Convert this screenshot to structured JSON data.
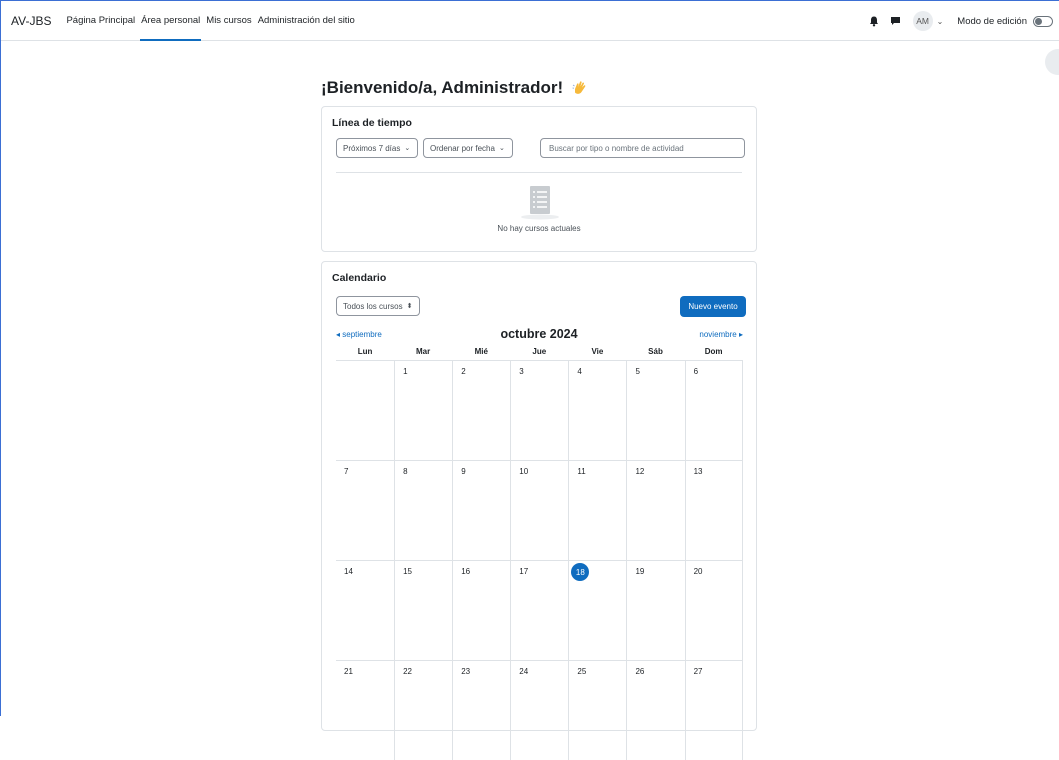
{
  "navbar": {
    "brand": "AV-JBS",
    "links": [
      {
        "label": "Página Principal"
      },
      {
        "label": "Área personal"
      },
      {
        "label": "Mis cursos"
      },
      {
        "label": "Administración del sitio"
      }
    ],
    "active_link": "Área personal",
    "avatar_initials": "AM",
    "edit_mode_label": "Modo de edición",
    "edit_mode_on": false
  },
  "page": {
    "welcome": "¡Bienvenido/a, Administrador!"
  },
  "timeline": {
    "title": "Línea de tiempo",
    "filter_label": "Próximos 7 días",
    "sort_label": "Ordenar por fecha",
    "search_placeholder": "Buscar por tipo o nombre de actividad",
    "empty_text": "No hay cursos actuales"
  },
  "calendar": {
    "title": "Calendario",
    "course_filter": "Todos los cursos",
    "new_event_label": "Nuevo evento",
    "prev_month": "septiembre",
    "next_month": "noviembre",
    "month_title": "octubre 2024",
    "weekdays": [
      "Lun",
      "Mar",
      "Mié",
      "Jue",
      "Vie",
      "Sáb",
      "Dom"
    ],
    "weeks": [
      [
        "",
        "1",
        "2",
        "3",
        "4",
        "5",
        "6"
      ],
      [
        "7",
        "8",
        "9",
        "10",
        "11",
        "12",
        "13"
      ],
      [
        "14",
        "15",
        "16",
        "17",
        "18",
        "19",
        "20"
      ],
      [
        "21",
        "22",
        "23",
        "24",
        "25",
        "26",
        "27"
      ]
    ],
    "today": "18"
  },
  "colors": {
    "accent": "#0f6cbf",
    "border": "#dee2e6"
  }
}
